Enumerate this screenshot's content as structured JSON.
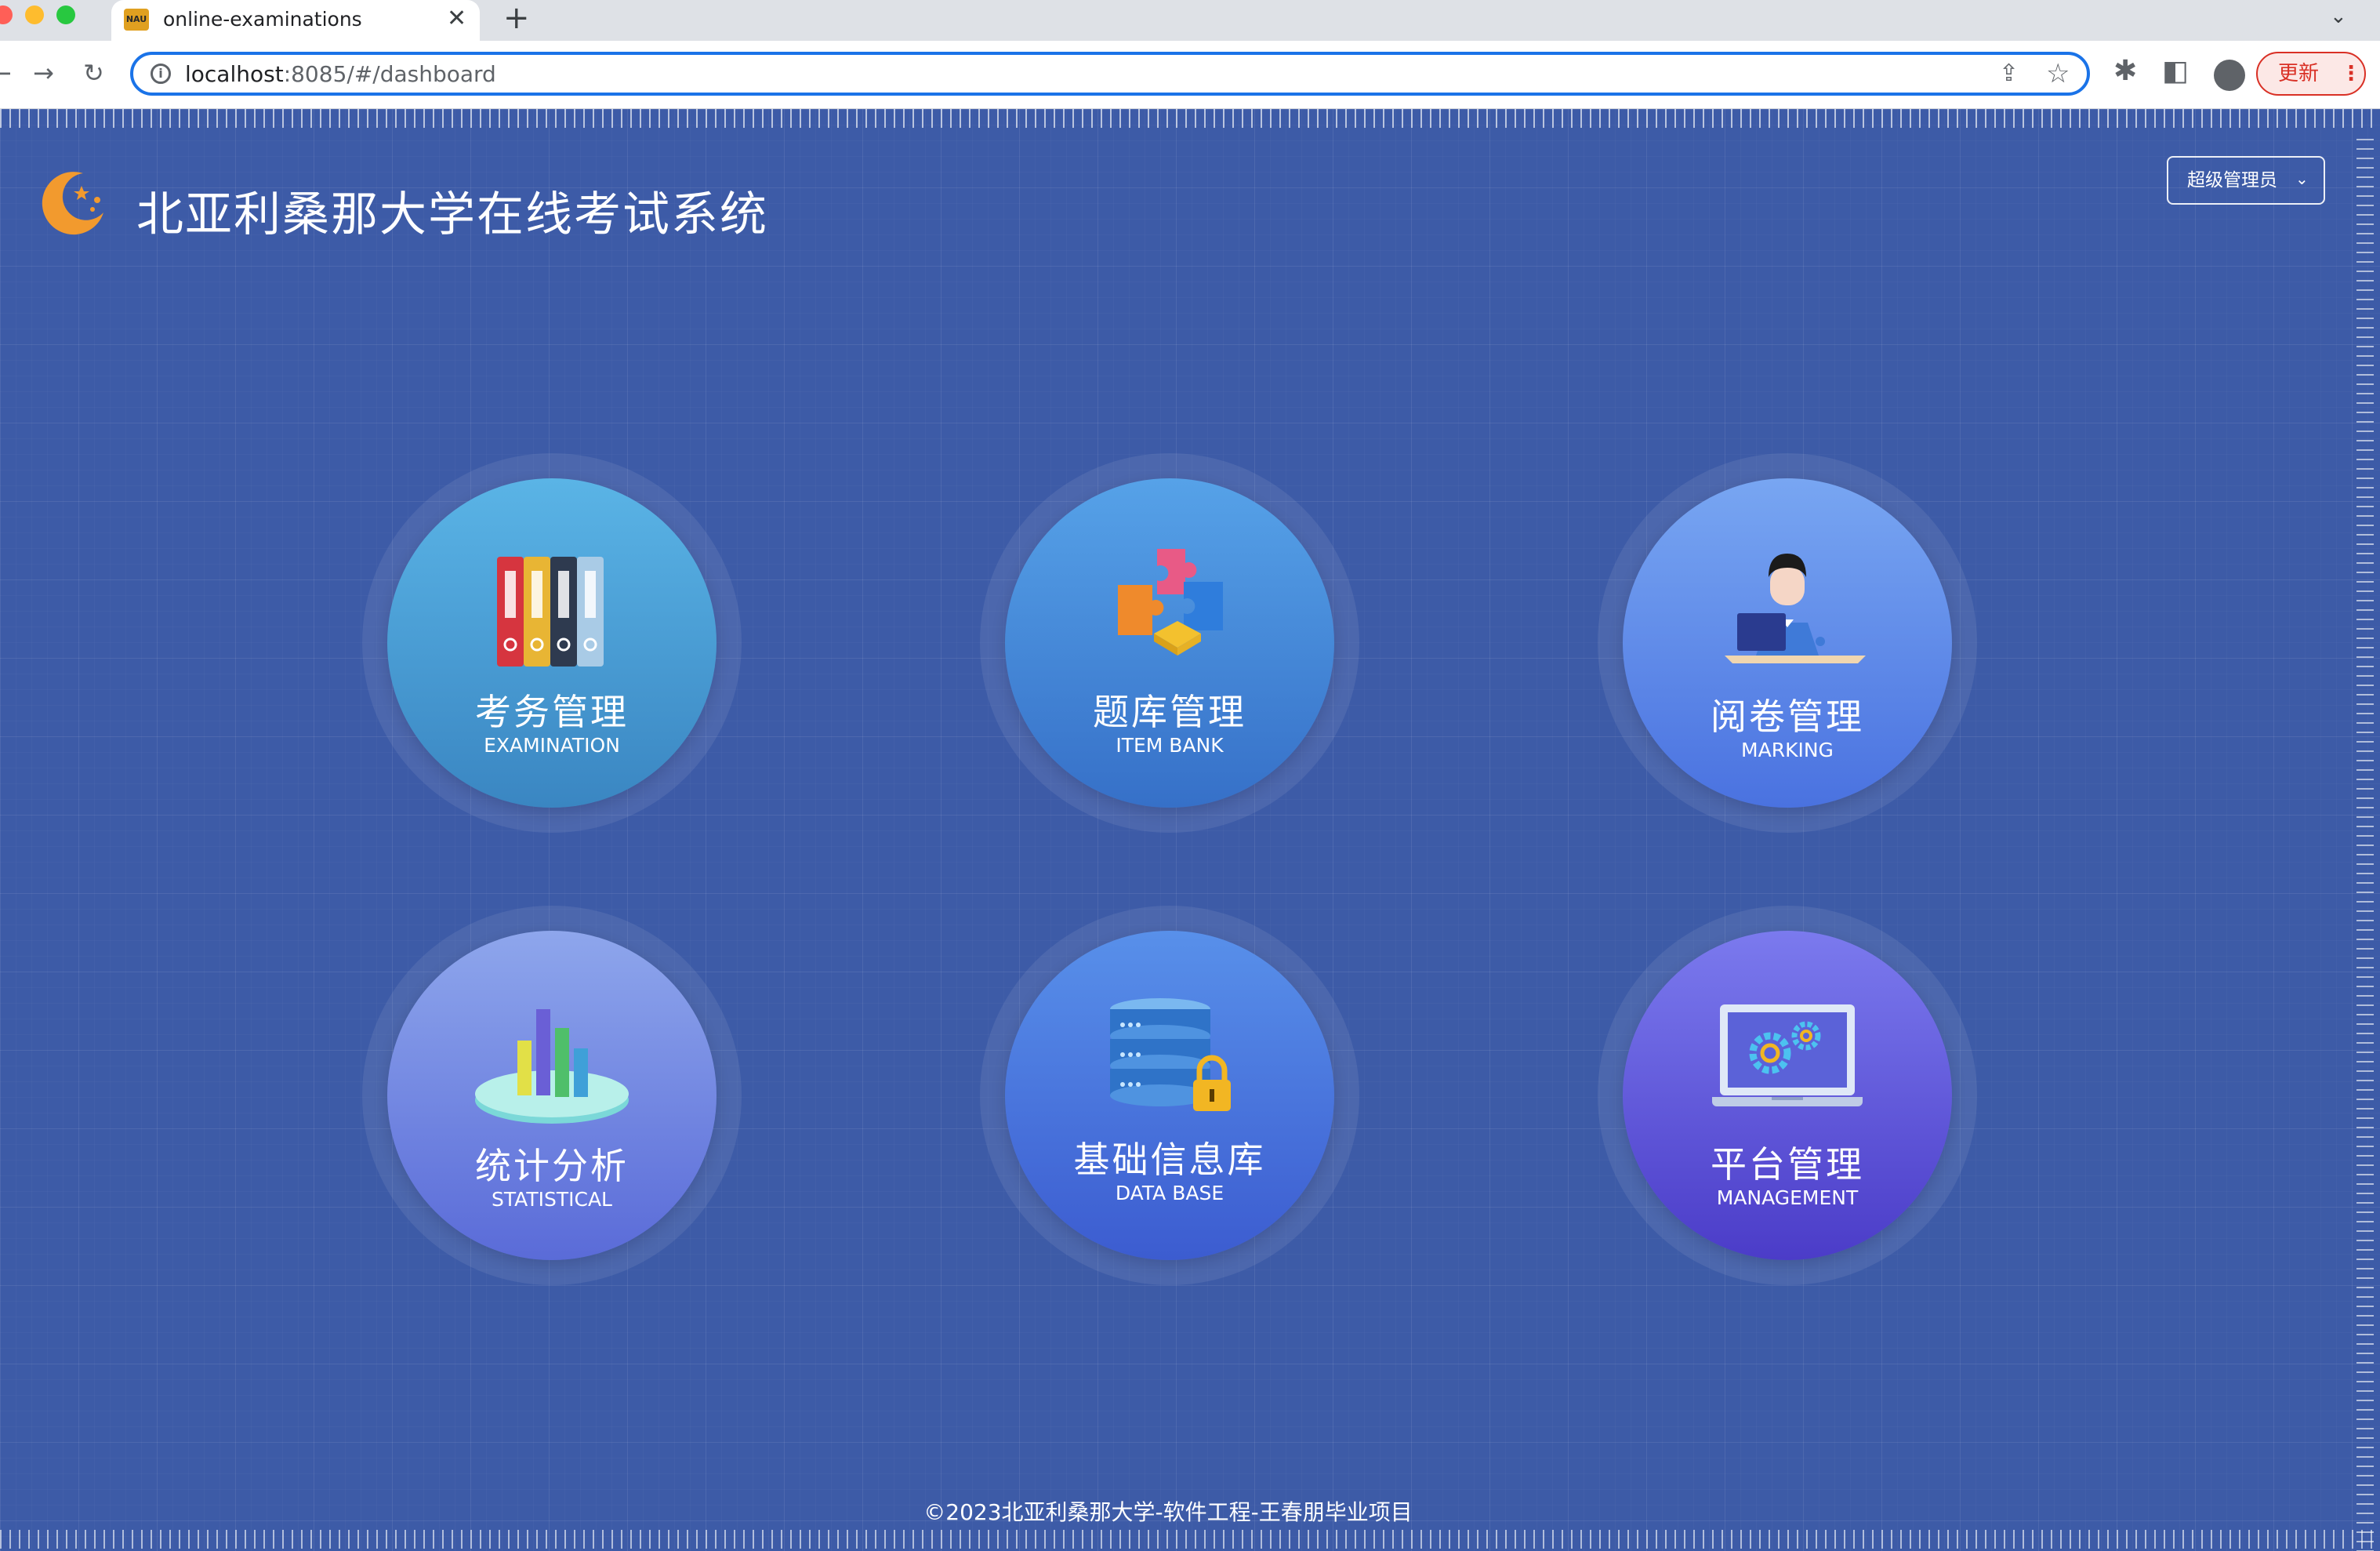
{
  "browser": {
    "tab_title": "online-examinations",
    "favicon_text": "NAU",
    "tab_close": "✕",
    "new_tab": "+",
    "tab_menu": "⌄",
    "url_host": "localhost",
    "url_path": ":8085/#/dashboard",
    "info_glyph": "i",
    "update_label": "更新",
    "update_menu": "⋮"
  },
  "header": {
    "title": "北亚利桑那大学在线考试系统",
    "user_menu": "超级管理员",
    "user_menu_chevron": "⌄"
  },
  "modules": [
    {
      "cn": "考务管理",
      "en": "EXAMINATION",
      "icon": "binders-icon",
      "gradient": [
        "#5ab4e6",
        "#3a86c2"
      ]
    },
    {
      "cn": "题库管理",
      "en": "ITEM BANK",
      "icon": "puzzle-icon",
      "gradient": [
        "#56a2e8",
        "#3670c8"
      ]
    },
    {
      "cn": "阅卷管理",
      "en": "MARKING",
      "icon": "teacher-laptop-icon",
      "gradient": [
        "#78a6f2",
        "#4a72e0"
      ]
    },
    {
      "cn": "统计分析",
      "en": "STATISTICAL",
      "icon": "bar-chart-icon",
      "gradient": [
        "#8ea6ec",
        "#5a6bd8"
      ]
    },
    {
      "cn": "基础信息库",
      "en": "DATA BASE",
      "icon": "database-lock-icon",
      "gradient": [
        "#5890ea",
        "#3c5cd0"
      ]
    },
    {
      "cn": "平台管理",
      "en": "MANAGEMENT",
      "icon": "laptop-gears-icon",
      "gradient": [
        "#7b7aee",
        "#4b3cc8"
      ]
    }
  ],
  "footer": {
    "copyright": "©2023北亚利桑那大学-软件工程-王春朋毕业项目"
  }
}
